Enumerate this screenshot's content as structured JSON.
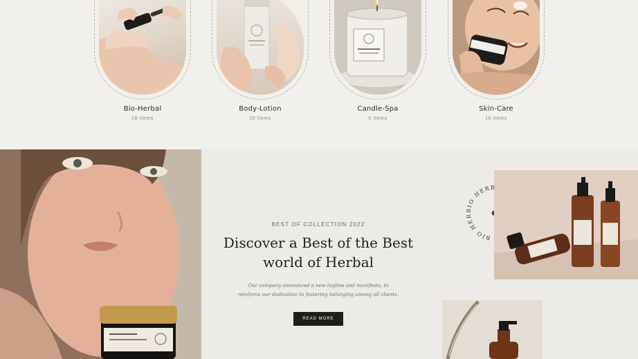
{
  "categories": [
    {
      "name": "Bio-Herbal",
      "count": "18 Items",
      "image": "hands-dropper-photo"
    },
    {
      "name": "Body-Lotion",
      "count": "10 Items",
      "image": "lotion-bottle-photo"
    },
    {
      "name": "Candle-Spa",
      "count": "5 Items",
      "image": "candle-photo"
    },
    {
      "name": "Skin-Care",
      "count": "16 Items",
      "image": "face-cream-photo"
    }
  ],
  "hero": {
    "eyebrow": "BEST OF COLLECTION 2022",
    "headline_line1": "Discover a Best of the Best",
    "headline_line2": "world of Herbal",
    "description_line1": "Our company announced a new tagline and manifesto, to",
    "description_line2": "reinforce our dedication to fostering belonging among all clients.",
    "button_label": "READ MORE",
    "badge_text": "BIO HERBAL · BIO HERBAL · BIO HERBAL ·"
  },
  "colors": {
    "background": "#f2f0ec",
    "hero_bg": "#ecebe7",
    "button": "#1f1e1c",
    "text": "#2b2a28"
  }
}
